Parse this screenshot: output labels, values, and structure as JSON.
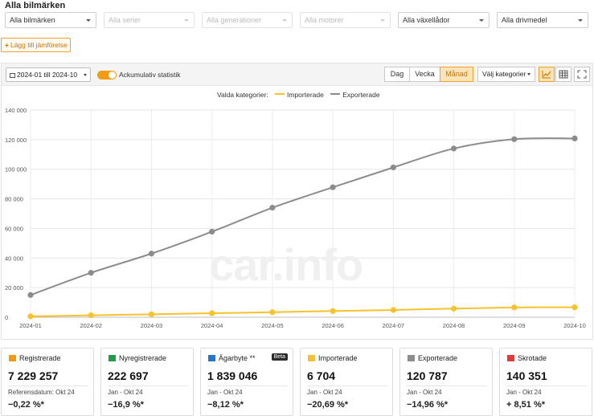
{
  "title": "Alla bilmärken",
  "filters": [
    {
      "label": "Alla bilmärken",
      "disabled": false
    },
    {
      "label": "Alla serier",
      "disabled": true
    },
    {
      "label": "Alla generationer",
      "disabled": true
    },
    {
      "label": "Alla motorer",
      "disabled": true
    },
    {
      "label": "Alla växellådor",
      "disabled": false
    },
    {
      "label": "Alla drivmedel",
      "disabled": false
    }
  ],
  "add_compare_label": "Lägg till jämförelse",
  "toolbar": {
    "date_range": "2024-01 till 2024-10",
    "cumulative_label": "Ackumulativ statistik",
    "cumulative_on": true,
    "periods": [
      "Dag",
      "Vecka",
      "Månad"
    ],
    "active_period": "Månad",
    "category_select": "Välj kategorier"
  },
  "legend": {
    "label": "Valda kategorier:",
    "items": [
      {
        "name": "Importerade",
        "color": "#f7c22c"
      },
      {
        "name": "Exporterade",
        "color": "#8c8c8c"
      }
    ]
  },
  "watermark": "car.info",
  "chart_data": {
    "type": "line",
    "x": [
      "2024-01",
      "2024-02",
      "2024-03",
      "2024-04",
      "2024-05",
      "2024-06",
      "2024-07",
      "2024-08",
      "2024-09",
      "2024-10"
    ],
    "y_ticks": [
      "0",
      "20 000",
      "40 000",
      "60 000",
      "80 000",
      "100 000",
      "120 000",
      "140 000"
    ],
    "ylim": [
      0,
      140000
    ],
    "grid": true,
    "series": [
      {
        "name": "Importerade",
        "color": "#f7c22c",
        "values": [
          600,
          1300,
          2000,
          2700,
          3400,
          4200,
          4900,
          5800,
          6600,
          6704
        ]
      },
      {
        "name": "Exporterade",
        "color": "#8c8c8c",
        "values": [
          15000,
          30000,
          43000,
          57800,
          74000,
          87800,
          101200,
          114000,
          120300,
          120787
        ]
      }
    ]
  },
  "cards": [
    {
      "title": "Registrerade",
      "color": "#f39c12",
      "value": "7 229 257",
      "sub": "Referensdatum: Okt 24",
      "change": "−0,22 %*",
      "badge": ""
    },
    {
      "title": "Nyregistrerade",
      "color": "#1e9e4a",
      "value": "222 697",
      "sub": "Jan - Okt 24",
      "change": "−16,9 %*",
      "badge": ""
    },
    {
      "title": "Ägarbyte **",
      "color": "#2178c8",
      "value": "1 839 046",
      "sub": "Jan - Okt 24",
      "change": "−8,12 %*",
      "badge": "Beta"
    },
    {
      "title": "Importerade",
      "color": "#f7c22c",
      "value": "6 704",
      "sub": "Jan - Okt 24",
      "change": "−20,69 %*",
      "badge": ""
    },
    {
      "title": "Exporterade",
      "color": "#8c8c8c",
      "value": "120 787",
      "sub": "Jan - Okt 24",
      "change": "−14,96 %*",
      "badge": ""
    },
    {
      "title": "Skrotade",
      "color": "#e53935",
      "value": "140 351",
      "sub": "Jan - Okt 24",
      "change": "+ 8,51 %*",
      "badge": ""
    }
  ]
}
